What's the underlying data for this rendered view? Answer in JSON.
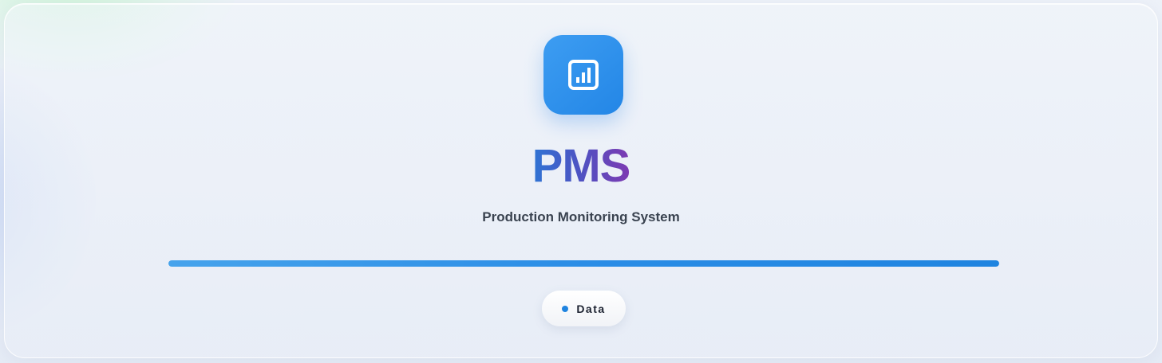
{
  "app": {
    "title": "PMS",
    "subtitle": "Production Monitoring System",
    "logo_icon": "chart-report-icon"
  },
  "progress": {
    "value": 1.0
  },
  "status": {
    "label": "Data",
    "dot_color": "#1f84e0"
  },
  "colors": {
    "accent": "#2386e6",
    "title_gradient_start": "#2f74d4",
    "title_gradient_end": "#7d3ab2"
  }
}
